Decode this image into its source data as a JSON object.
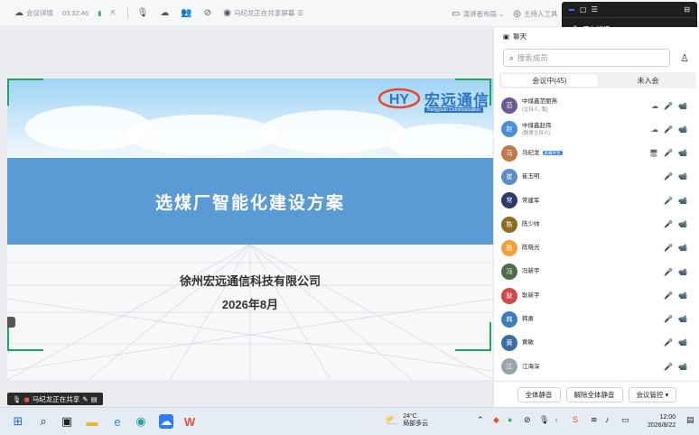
{
  "topbar": {
    "meeting_label": "会议详情",
    "timer": "03:32:46",
    "speaking_notice": "马纪龙正在共享屏幕",
    "layout_label": "演讲者布局",
    "host_tools_label": "主持人工具"
  },
  "speak_widget": {
    "speaking_label": "正在讲话:"
  },
  "mini_share_bar": {
    "text": "马纪龙正在共享屏幕"
  },
  "slide": {
    "logo_text": "宏远通信",
    "logo_sub": "Hongyuan Communication",
    "title": "选煤厂智能化建设方案",
    "company": "徐州宏远通信科技有限公司",
    "date": "2026年8月"
  },
  "sharing_status": {
    "text": "马纪龙正在共享"
  },
  "panel": {
    "header": "聊天",
    "search_placeholder": "搜索成员",
    "tabs": [
      {
        "label": "会议中(45)",
        "active": true
      },
      {
        "label": "未入会",
        "active": false
      }
    ],
    "members": [
      {
        "name": "中煤鑫范丽燕",
        "role": "(主持人, 我)",
        "color": "#6b5b95",
        "initial": "范",
        "icons": [
          "cloud",
          "mic-off",
          "cam-off"
        ]
      },
      {
        "name": "中煤鑫赵伟",
        "role": "(联席主持人)",
        "color": "#4a90d9",
        "initial": "赵",
        "icons": [
          "cloud",
          "mic-off",
          "cam-off"
        ]
      },
      {
        "name": "马纪龙",
        "role": "",
        "badge": "屏幕共享",
        "color": "#c0784f",
        "initial": "马",
        "icons": [
          "screen",
          "mic-on",
          "cam-off"
        ]
      },
      {
        "name": "崔玉明",
        "role": "",
        "color": "#5b8dc9",
        "initial": "崔",
        "icons": [
          "mic-on",
          "cam-off"
        ]
      },
      {
        "name": "常建军",
        "role": "",
        "color": "#2b3a6b",
        "initial": "常",
        "icons": [
          "mic-off",
          "cam-off"
        ]
      },
      {
        "name": "陈少帅",
        "role": "",
        "color": "#8a6d1f",
        "initial": "陈",
        "icons": [
          "mic-off",
          "cam-off"
        ]
      },
      {
        "name": "陈晓光",
        "role": "",
        "color": "#f2a03d",
        "initial": "陈",
        "icons": [
          "mic-off",
          "cam-off"
        ]
      },
      {
        "name": "冯新宇",
        "role": "",
        "color": "#4f6b4a",
        "initial": "冯",
        "icons": [
          "mic-off",
          "cam-off"
        ]
      },
      {
        "name": "耿新宇",
        "role": "",
        "color": "#d24a4a",
        "initial": "耿",
        "icons": [
          "mic-off",
          "cam-off"
        ]
      },
      {
        "name": "韩勇",
        "role": "",
        "color": "#3c7fb8",
        "initial": "韩",
        "icons": [
          "mic-off",
          "cam-off"
        ]
      },
      {
        "name": "黄敏",
        "role": "",
        "color": "#3a6ea5",
        "initial": "黄",
        "icons": [
          "mic-off",
          "cam-off"
        ]
      },
      {
        "name": "江海深",
        "role": "",
        "color": "#9aa4ad",
        "initial": "江",
        "icons": [
          "mic-off",
          "cam-off"
        ]
      }
    ],
    "footer": {
      "mute_all": "全体静音",
      "unmute_all": "解除全体静音",
      "meeting_control": "会议管控 ▾"
    }
  },
  "taskbar": {
    "weather_temp": "24°C",
    "weather_desc": "局部多云",
    "time": "12:00",
    "date": "2026/8/22"
  }
}
